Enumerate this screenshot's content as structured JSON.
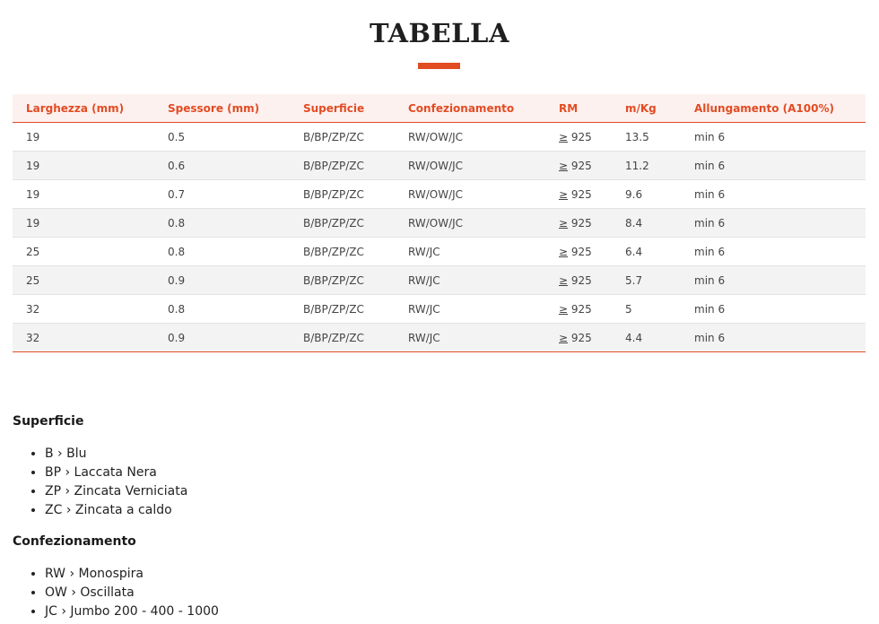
{
  "title": "TABELLA",
  "accent_color": "#e24c23",
  "table": {
    "headers": [
      "Larghezza (mm)",
      "Spessore (mm)",
      "Superficie",
      "Confezionamento",
      "RM",
      "m/Kg",
      "Allungamento (A100%)"
    ],
    "rm_prefix": "≥",
    "rows": [
      {
        "larghezza": "19",
        "spessore": "0.5",
        "superficie": "B/BP/ZP/ZC",
        "confezionamento": "RW/OW/JC",
        "rm": "925",
        "mkg": "13.5",
        "allungamento": "min 6"
      },
      {
        "larghezza": "19",
        "spessore": "0.6",
        "superficie": "B/BP/ZP/ZC",
        "confezionamento": "RW/OW/JC",
        "rm": "925",
        "mkg": "11.2",
        "allungamento": "min 6"
      },
      {
        "larghezza": "19",
        "spessore": "0.7",
        "superficie": "B/BP/ZP/ZC",
        "confezionamento": "RW/OW/JC",
        "rm": "925",
        "mkg": "9.6",
        "allungamento": "min 6"
      },
      {
        "larghezza": "19",
        "spessore": "0.8",
        "superficie": "B/BP/ZP/ZC",
        "confezionamento": "RW/OW/JC",
        "rm": "925",
        "mkg": "8.4",
        "allungamento": "min 6"
      },
      {
        "larghezza": "25",
        "spessore": "0.8",
        "superficie": "B/BP/ZP/ZC",
        "confezionamento": "RW/JC",
        "rm": "925",
        "mkg": "6.4",
        "allungamento": "min 6"
      },
      {
        "larghezza": "25",
        "spessore": "0.9",
        "superficie": "B/BP/ZP/ZC",
        "confezionamento": "RW/JC",
        "rm": "925",
        "mkg": "5.7",
        "allungamento": "min 6"
      },
      {
        "larghezza": "32",
        "spessore": "0.8",
        "superficie": "B/BP/ZP/ZC",
        "confezionamento": "RW/JC",
        "rm": "925",
        "mkg": "5",
        "allungamento": "min 6"
      },
      {
        "larghezza": "32",
        "spessore": "0.9",
        "superficie": "B/BP/ZP/ZC",
        "confezionamento": "RW/JC",
        "rm": "925",
        "mkg": "4.4",
        "allungamento": "min 6"
      }
    ]
  },
  "superficie": {
    "title": "Superficie",
    "items": [
      "B › Blu",
      "BP › Laccata Nera",
      "ZP › Zincata Verniciata",
      "ZC › Zincata a caldo"
    ]
  },
  "confezionamento": {
    "title": "Confezionamento",
    "items": [
      "RW › Monospira",
      "OW › Oscillata",
      "JC › Jumbo 200 - 400 - 1000"
    ]
  }
}
